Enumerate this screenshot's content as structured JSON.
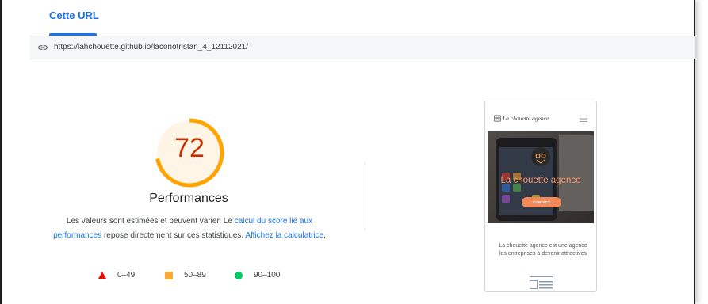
{
  "tabs": [
    {
      "label": "Cette URL",
      "active": true
    }
  ],
  "url": {
    "icon": "link-icon",
    "text": "https://lahchouette.github.io/laconotristan_4_12112021/"
  },
  "score": {
    "value": 72,
    "fraction": 0.72,
    "color": "#ffa400",
    "text_color": "#c33300",
    "title": "Performances"
  },
  "description": {
    "part1": "Les valeurs sont estimées et peuvent varier. Le ",
    "link1": "calcul du score lié aux performances",
    "part2": " repose directement sur ces statistiques. ",
    "link2": "Affichez la calculatrice",
    "part3": "."
  },
  "legend": [
    {
      "range": "0–49",
      "shape": "triangle",
      "color": "#eb0f00"
    },
    {
      "range": "50–89",
      "shape": "square",
      "color": "#ffaa33"
    },
    {
      "range": "90–100",
      "shape": "circle",
      "color": "#00cc66"
    }
  ],
  "preview": {
    "brand": "La chouette agence",
    "hero_title": "La chouette agence",
    "button_label": "CONTACT",
    "text_line1": "La chouette agence est une agence",
    "text_line2": "les entreprises à devenir attractives"
  }
}
